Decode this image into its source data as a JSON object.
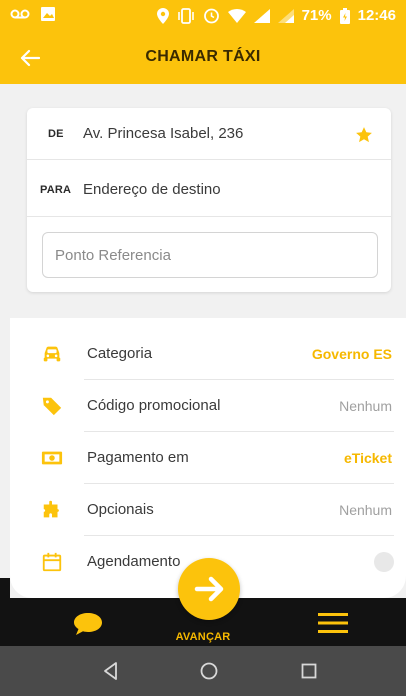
{
  "status_bar": {
    "battery": "71%",
    "time": "12:46"
  },
  "app_bar": {
    "title": "CHAMAR TÁXI"
  },
  "addresses": {
    "from_tag": "DE",
    "from_address": "Av. Princesa Isabel, 236",
    "to_tag": "PARA",
    "to_address": "Endereço de destino",
    "reference_placeholder": "Ponto Referencia"
  },
  "options": [
    {
      "label": "Categoria",
      "value": "Governo ES",
      "icon": "car-icon"
    },
    {
      "label": "Código promocional",
      "value": "Nenhum",
      "icon": "tag-icon"
    },
    {
      "label": "Pagamento em",
      "value": "eTicket",
      "icon": "money-icon"
    },
    {
      "label": "Opcionais",
      "value": "Nenhum",
      "icon": "puzzle-icon"
    },
    {
      "label": "Agendamento",
      "value": "",
      "icon": "calendar-icon"
    }
  ],
  "bottom_bar": {
    "advance_label": "AVANÇAR"
  },
  "colors": {
    "brand_yellow": "#fcc30c",
    "accent_text": "#f6b800",
    "dark": "#121212",
    "nav_gray": "#4a4a4a"
  }
}
